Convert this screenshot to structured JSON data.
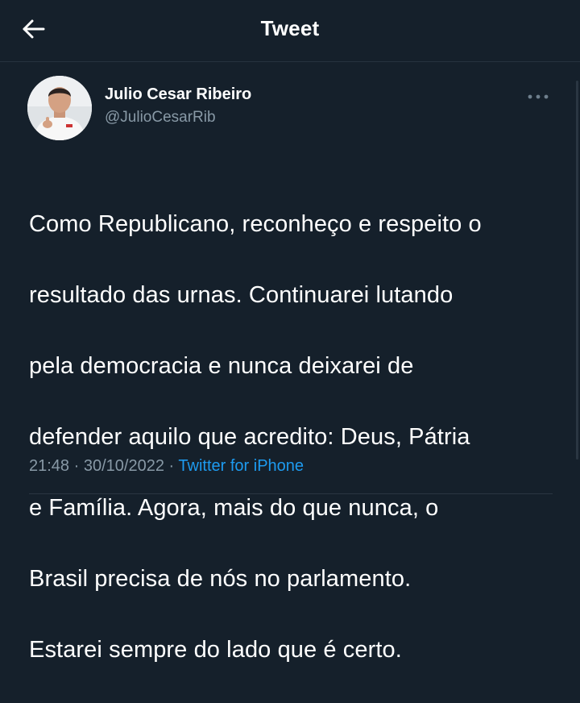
{
  "header": {
    "title": "Tweet",
    "back_icon": "arrow-left-icon"
  },
  "tweet": {
    "author_name": "Julio Cesar Ribeiro",
    "author_handle": "@JulioCesarRib",
    "more_icon": "more-horizontal-icon",
    "lines": [
      "Como Republicano, reconheço e respeito o",
      "resultado das urnas. Continuarei lutando",
      "pela democracia e nunca deixarei de",
      "defender aquilo que acredito: Deus, Pátria",
      "e Família. Agora, mais do que nunca, o",
      "Brasil precisa de nós no parlamento.",
      "Estarei sempre do lado que é certo."
    ],
    "time": "21:48",
    "date": "30/10/2022",
    "separator": "·",
    "source": "Twitter for iPhone"
  },
  "colors": {
    "background": "#15202b",
    "secondary_text": "#8899a6",
    "link": "#1d9bf0"
  }
}
